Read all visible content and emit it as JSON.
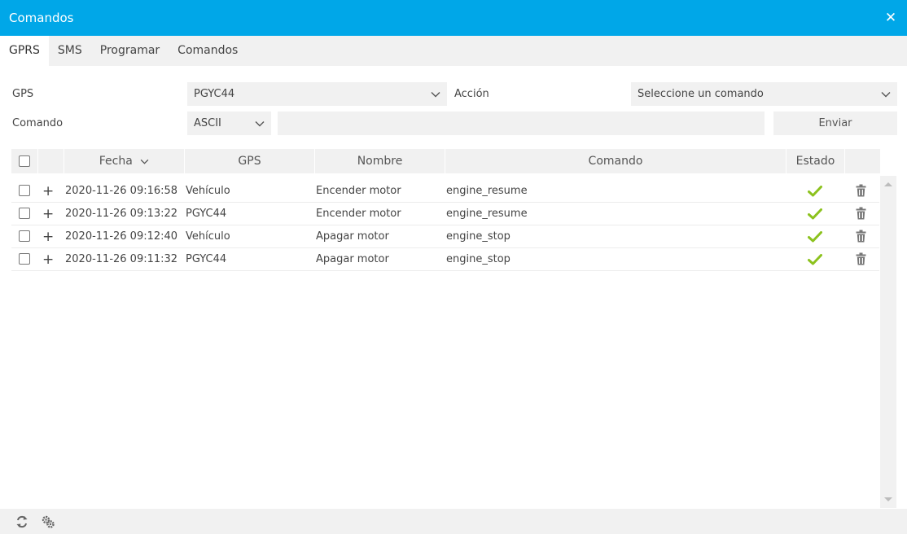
{
  "window": {
    "title": "Comandos",
    "close_icon": "close-icon"
  },
  "tabs": [
    {
      "label": "GPRS",
      "active": true
    },
    {
      "label": "SMS"
    },
    {
      "label": "Programar"
    },
    {
      "label": "Comandos"
    }
  ],
  "form": {
    "gps_label": "GPS",
    "gps_value": "PGYC44",
    "accion_label": "Acción",
    "accion_value": "Seleccione un comando",
    "comando_label": "Comando",
    "format_value": "ASCII",
    "command_text": "",
    "send_label": "Enviar"
  },
  "table": {
    "headers": {
      "fecha": "Fecha",
      "gps": "GPS",
      "nombre": "Nombre",
      "comando": "Comando",
      "estado": "Estado"
    },
    "sort_icon": "chevron-down-icon",
    "rows": [
      {
        "fecha": "2020-11-26 09:16:58",
        "gps": "Vehículo",
        "nombre": "Encender motor",
        "comando": "engine_resume",
        "estado": "check-icon"
      },
      {
        "fecha": "2020-11-26 09:13:22",
        "gps": "PGYC44",
        "nombre": "Encender motor",
        "comando": "engine_resume",
        "estado": "check-icon"
      },
      {
        "fecha": "2020-11-26 09:12:40",
        "gps": "Vehículo",
        "nombre": "Apagar motor",
        "comando": "engine_stop",
        "estado": "check-icon"
      },
      {
        "fecha": "2020-11-26 09:11:32",
        "gps": "PGYC44",
        "nombre": "Apagar motor",
        "comando": "engine_stop",
        "estado": "check-icon"
      }
    ]
  },
  "footer": {
    "icons": [
      "refresh-icon",
      "settings-icon"
    ]
  },
  "colors": {
    "titlebar": "#00a7e8",
    "check": "#8cc21e",
    "panel": "#f1f1f1"
  }
}
